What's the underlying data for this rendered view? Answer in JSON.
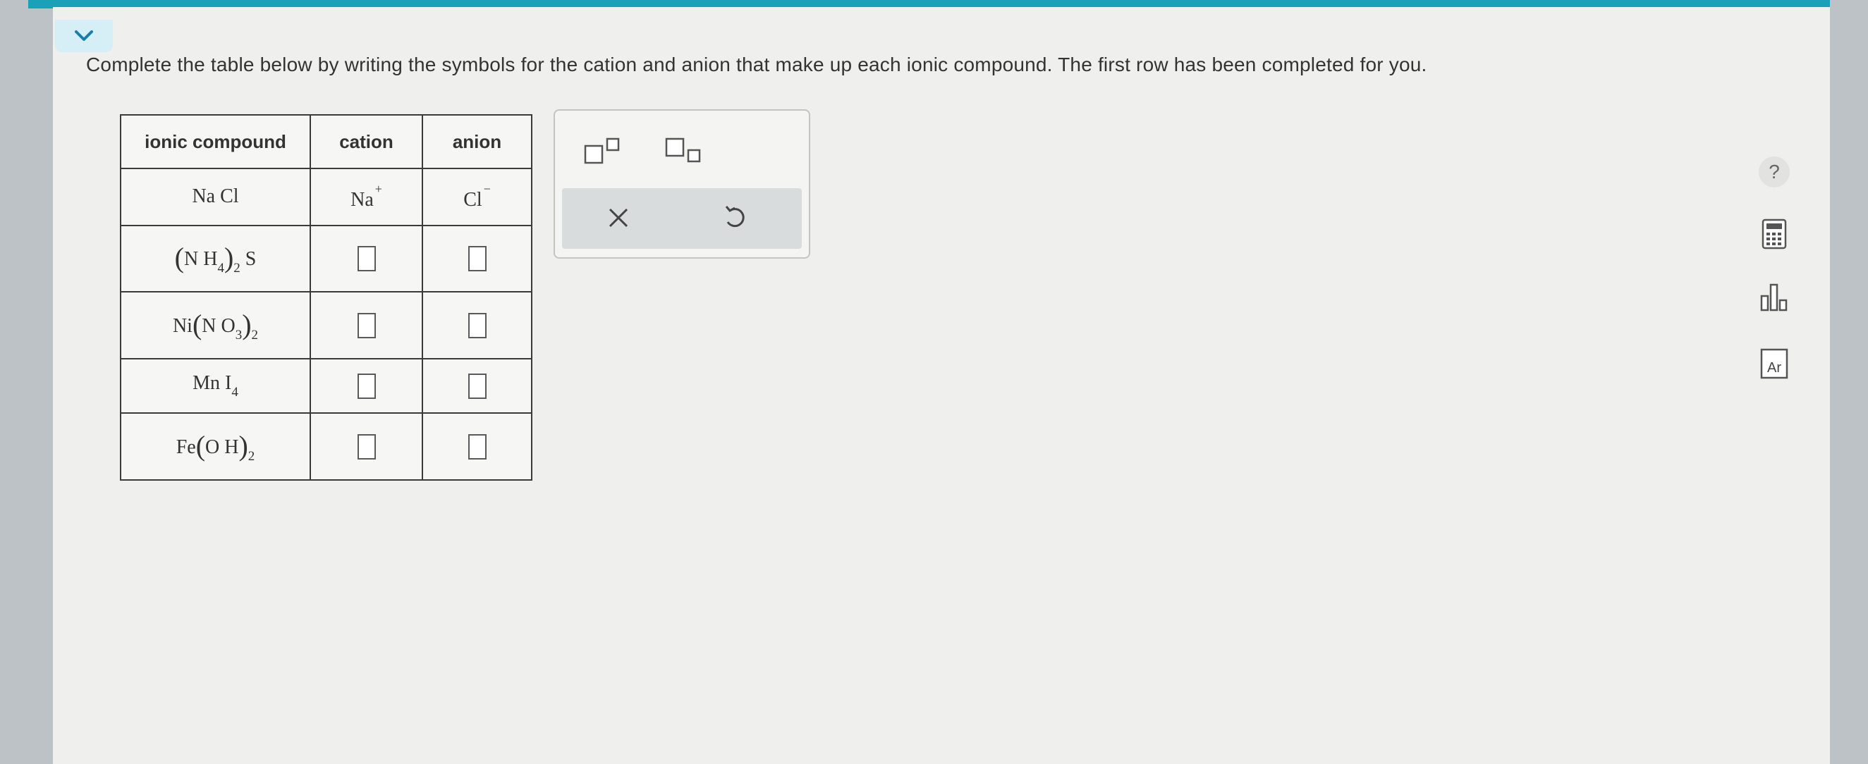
{
  "instructions": "Complete the table below by writing the symbols for the cation and anion that make up each ionic compound. The first row has been completed for you.",
  "table": {
    "headers": [
      "ionic compound",
      "cation",
      "anion"
    ],
    "row1": {
      "compound": "NaCl",
      "cation": "Na",
      "cation_charge": "+",
      "anion": "Cl",
      "anion_charge": "−"
    },
    "row2": {
      "compound": "(NH4)2S"
    },
    "row3": {
      "compound": "Ni(NO3)2"
    },
    "row4": {
      "compound": "MnI4"
    },
    "row5": {
      "compound": "Fe(OH)2"
    }
  },
  "toolbox": {
    "clear_symbol": "×",
    "undo_symbol": "↺"
  },
  "side_tools": {
    "help_symbol": "?",
    "periodic_symbol": "Ar"
  },
  "colors": {
    "accent": "#1aa0b7",
    "collapse_bg": "#d6eef6"
  }
}
